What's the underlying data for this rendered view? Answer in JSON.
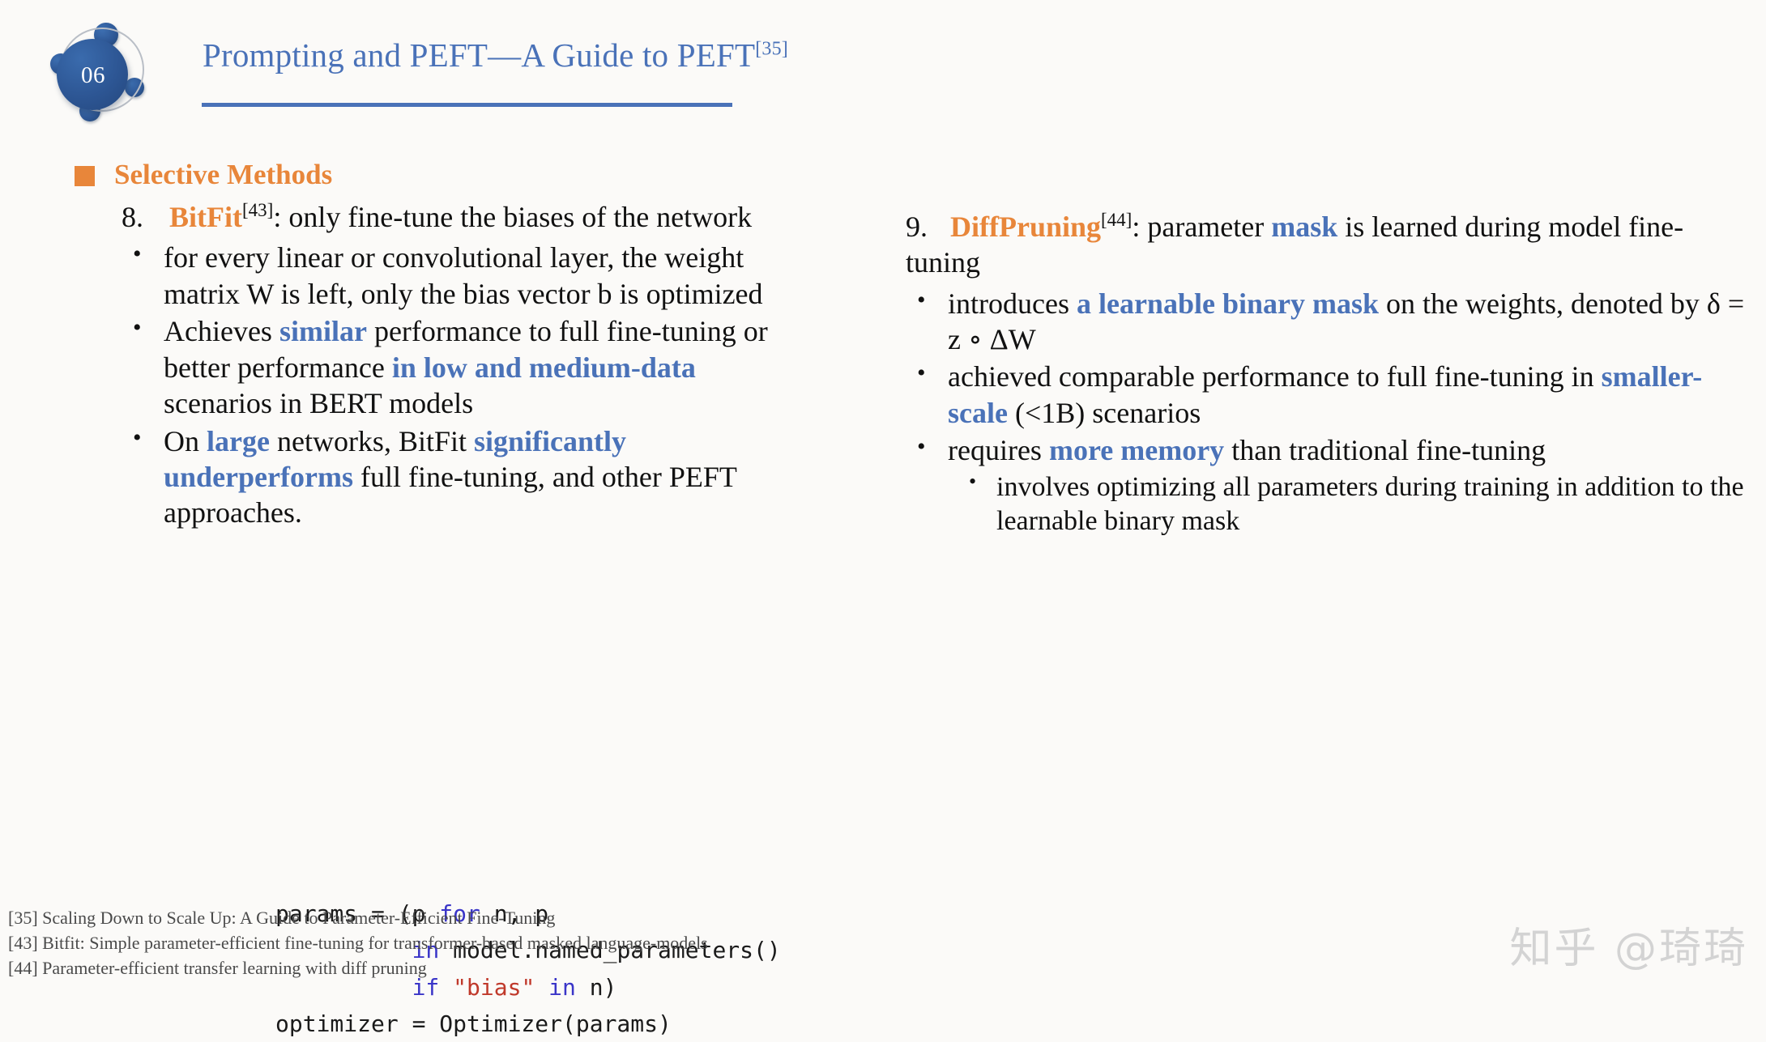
{
  "header": {
    "badge_number": "06",
    "title_text": "Prompting and PEFT—A Guide to PEFT",
    "title_superscript": "[35]"
  },
  "section": {
    "heading": "Selective Methods"
  },
  "left_column": {
    "item_number": "8.",
    "item_title": "BitFit",
    "item_title_superscript": "[43]",
    "item_body": ": only fine-tune the biases of the network",
    "bullets": [
      {
        "parts": [
          {
            "text": "for every linear or convolutional layer, the weight matrix W is left, only the bias vector b is optimized",
            "style": "plain"
          }
        ]
      },
      {
        "parts": [
          {
            "text": "Achieves ",
            "style": "plain"
          },
          {
            "text": "similar",
            "style": "blue"
          },
          {
            "text": " performance to full fine-tuning or better performance ",
            "style": "plain"
          },
          {
            "text": "in low and medium-data",
            "style": "blue"
          },
          {
            "text": " scenarios in BERT models",
            "style": "plain"
          }
        ]
      },
      {
        "parts": [
          {
            "text": "On ",
            "style": "plain"
          },
          {
            "text": "large",
            "style": "blue"
          },
          {
            "text": " networks, BitFit ",
            "style": "plain"
          },
          {
            "text": "significantly underperforms",
            "style": "blue"
          },
          {
            "text": " full fine-tuning, and other PEFT approaches.",
            "style": "plain"
          }
        ]
      }
    ]
  },
  "right_column": {
    "item_number": "9.",
    "item_title": "DiffPruning",
    "item_title_superscript": "[44]",
    "item_body_pre": ": parameter ",
    "item_body_blue": "mask",
    "item_body_post": " is learned during model fine-tuning",
    "bullets": [
      {
        "parts": [
          {
            "text": "introduces ",
            "style": "plain"
          },
          {
            "text": "a learnable binary mask",
            "style": "blue"
          },
          {
            "text": " on the weights, denoted by δ = z ∘ ΔW",
            "style": "plain"
          }
        ]
      },
      {
        "parts": [
          {
            "text": "achieved comparable performance to full fine-tuning in ",
            "style": "plain"
          },
          {
            "text": "smaller-scale",
            "style": "blue"
          },
          {
            "text": " (<1B) scenarios",
            "style": "plain"
          }
        ]
      },
      {
        "parts": [
          {
            "text": "requires ",
            "style": "plain"
          },
          {
            "text": "more memory",
            "style": "blue"
          },
          {
            "text": " than traditional fine-tuning",
            "style": "plain"
          }
        ],
        "sub": [
          "involves optimizing all parameters during training in addition to the learnable binary mask"
        ]
      }
    ]
  },
  "code": {
    "lines": [
      [
        {
          "t": "params = (p ",
          "c": "plain"
        },
        {
          "t": "for",
          "c": "kw"
        },
        {
          "t": " n, p",
          "c": "plain"
        }
      ],
      [
        {
          "t": "          ",
          "c": "plain"
        },
        {
          "t": "in",
          "c": "kw"
        },
        {
          "t": " model.named_parameters()",
          "c": "plain"
        }
      ],
      [
        {
          "t": "          ",
          "c": "plain"
        },
        {
          "t": "if",
          "c": "kw"
        },
        {
          "t": " ",
          "c": "plain"
        },
        {
          "t": "\"bias\"",
          "c": "str"
        },
        {
          "t": " ",
          "c": "plain"
        },
        {
          "t": "in",
          "c": "kw"
        },
        {
          "t": " n)",
          "c": "plain"
        }
      ],
      [
        {
          "t": "optimizer = Optimizer(params)",
          "c": "plain"
        }
      ]
    ]
  },
  "footnotes": [
    "[35] Scaling Down to Scale Up: A Guide to Parameter-Efficient Fine-Tuning",
    "[43] Bitfit: Simple parameter-efficient fine-tuning for transformer-based masked language-models",
    "[44] Parameter-efficient transfer learning with diff pruning"
  ],
  "watermark": {
    "text": "知乎 @琦琦"
  },
  "colors": {
    "title_blue": "#4A72B8",
    "accent_orange": "#E8863A",
    "highlight_blue": "#4A72B8",
    "body_black": "#111111",
    "code_keyword": "#3A35C8",
    "code_string": "#C0392B",
    "background": "#FBFAF8",
    "watermark_gray": "#D3D3D3"
  }
}
